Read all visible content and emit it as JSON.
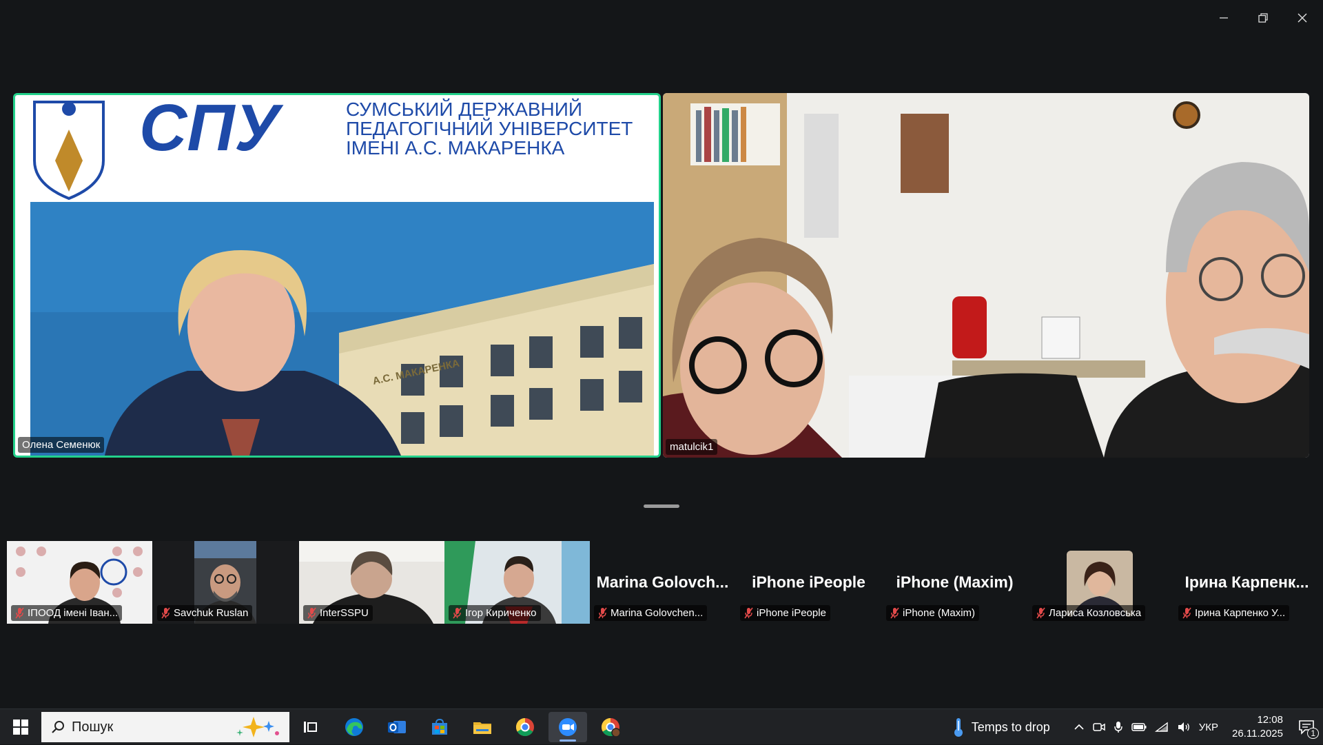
{
  "window": {
    "controls": [
      "minimize",
      "restore",
      "close"
    ]
  },
  "main_tiles": [
    {
      "name": "Олена Семенюк",
      "active_speaker": true
    },
    {
      "name": "matulcik1"
    }
  ],
  "slide": {
    "logo_text": "СПУ",
    "university_line1": "СУМСЬКИЙ ДЕРЖАВНИЙ",
    "university_line2": "ПЕДАГОГІЧНИЙ УНІВЕРСИТЕТ",
    "university_line3": "ІМЕНІ А.С. МАКАРЕНКА",
    "building_sign": "А.С. МАКАРЕНКА"
  },
  "gallery": [
    {
      "tile_name": "",
      "label": "ІПООД імені Іван...",
      "muted": true,
      "video": true
    },
    {
      "tile_name": "",
      "label": "Savchuk Ruslan",
      "muted": true,
      "video": true
    },
    {
      "tile_name": "",
      "label": "InterSSPU",
      "muted": true,
      "video": true
    },
    {
      "tile_name": "",
      "label": "Ігор Кириченко",
      "muted": true,
      "video": true
    },
    {
      "tile_name": "Marina Golovch...",
      "label": "Marina Golovchen...",
      "muted": true,
      "video": false
    },
    {
      "tile_name": "iPhone iPeople",
      "label": "iPhone iPeople",
      "muted": true,
      "video": false
    },
    {
      "tile_name": "iPhone (Maxim)",
      "label": "iPhone (Maxim)",
      "muted": true,
      "video": false
    },
    {
      "tile_name": "",
      "label": "Лариса Козловська",
      "muted": true,
      "video": false,
      "avatar": true
    },
    {
      "tile_name": "Ірина Карпенк...",
      "label": "Ірина Карпенко У...",
      "muted": true,
      "video": false
    }
  ],
  "taskbar": {
    "search_placeholder": "Пошук",
    "apps": [
      "task-view",
      "edge",
      "outlook",
      "store",
      "file-explorer",
      "chrome",
      "zoom",
      "chrome-profile"
    ],
    "weather": "Temps to drop",
    "language": "УКР",
    "time": "12:08",
    "date": "26.11.2025",
    "notifications_count": "1"
  },
  "colors": {
    "active_speaker_border": "#23d18b",
    "mute_red": "#e24a4a",
    "taskbar": "#202225",
    "background": "#141618"
  }
}
